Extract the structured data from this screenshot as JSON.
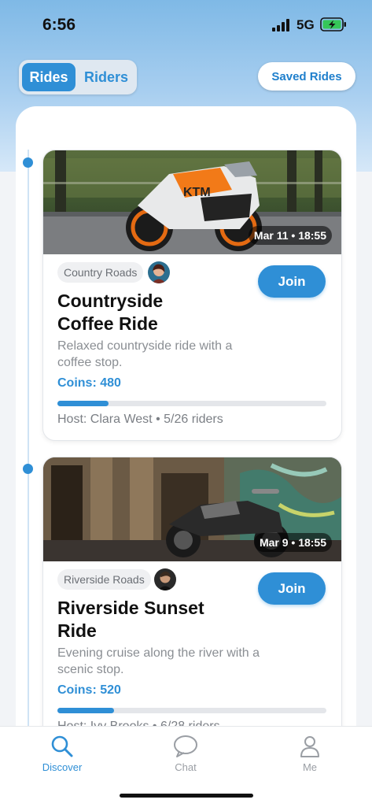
{
  "status_bar": {
    "time": "6:56",
    "network": "5G"
  },
  "segmented": {
    "rides_label": "Rides",
    "riders_label": "Riders",
    "active": "Rides"
  },
  "saved_rides_label": "Saved Rides",
  "rides": [
    {
      "date": "Mar 11 • 18:55",
      "tag": "Country Roads",
      "title": "Countryside Coffee Ride",
      "description": "Relaxed countryside ride with a coffee stop.",
      "coins": "Coins: 480",
      "progress": 0.19,
      "host": "Host: Clara West • 5/26 riders",
      "join_label": "Join"
    },
    {
      "date": "Mar 9 • 18:55",
      "tag": "Riverside Roads",
      "title": "Riverside Sunset Ride",
      "description": "Evening cruise along the river with a scenic stop.",
      "coins": "Coins: 520",
      "progress": 0.21,
      "host": "Host: Ivy Brooks • 6/28 riders",
      "join_label": "Join"
    }
  ],
  "tabs": [
    {
      "label": "Discover",
      "icon": "search-icon",
      "active": true
    },
    {
      "label": "Chat",
      "icon": "chat-icon",
      "active": false
    },
    {
      "label": "Me",
      "icon": "person-icon",
      "active": false
    }
  ],
  "colors": {
    "accent": "#2f8fd6",
    "inactive": "#9a9ea4"
  }
}
